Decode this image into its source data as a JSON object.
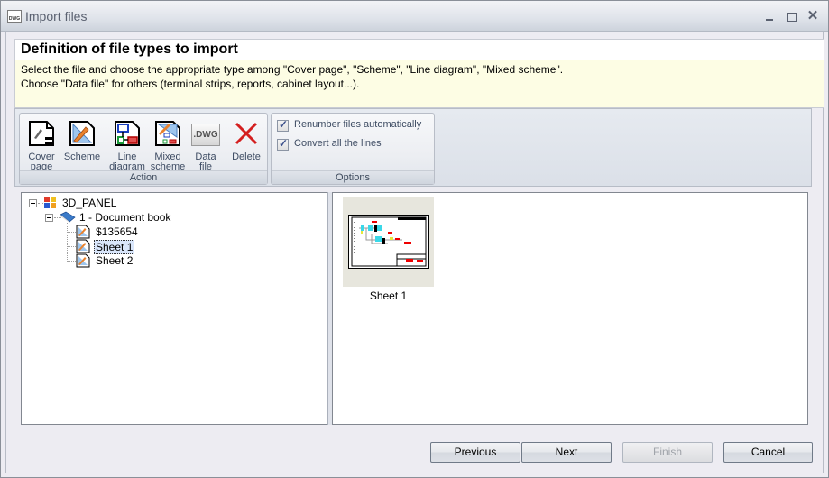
{
  "window": {
    "title": "Import files",
    "app_icon": "dwg-file-icon",
    "controls": {
      "minimize": "minimize-icon",
      "maximize": "maximize-icon",
      "close": "close-icon",
      "close_glyph": "✕"
    }
  },
  "header": {
    "title": "Definition of file types to import",
    "line1": "Select the file and choose the appropriate type among \"Cover page\", \"Scheme\", \"Line diagram\", \"Mixed scheme\".",
    "line2": "Choose \"Data file\" for others (terminal strips, reports, cabinet layout...)."
  },
  "ribbon": {
    "action_group": {
      "label": "Action",
      "buttons": [
        {
          "line1": "Cover",
          "line2": "page",
          "icon": "cover-page-icon"
        },
        {
          "line1": "Scheme",
          "line2": "",
          "icon": "scheme-icon"
        },
        {
          "line1": "Line",
          "line2": "diagram",
          "icon": "line-diagram-icon"
        },
        {
          "line1": "Mixed",
          "line2": "scheme",
          "icon": "mixed-scheme-icon"
        },
        {
          "line1": "Data",
          "line2": "file",
          "icon": "data-file-icon",
          "icon_text": ".DWG"
        },
        {
          "line1": "Delete",
          "line2": "",
          "icon": "delete-icon"
        }
      ]
    },
    "options_group": {
      "label": "Options",
      "checkboxes": [
        {
          "label": "Renumber files automatically",
          "checked": true
        },
        {
          "label": "Convert all the lines",
          "checked": true
        }
      ]
    }
  },
  "tree": {
    "root": {
      "label": "3D_PANEL",
      "expanded": true
    },
    "book": {
      "label": "1 - Document book",
      "expanded": true
    },
    "items": [
      {
        "label": "$135654",
        "selected": false
      },
      {
        "label": "Sheet 1",
        "selected": true
      },
      {
        "label": "Sheet 2",
        "selected": false
      }
    ]
  },
  "preview": {
    "items": [
      {
        "label": "Sheet 1"
      }
    ]
  },
  "footer": {
    "previous": "Previous",
    "next": "Next",
    "finish": "Finish",
    "finish_enabled": false,
    "cancel": "Cancel"
  }
}
